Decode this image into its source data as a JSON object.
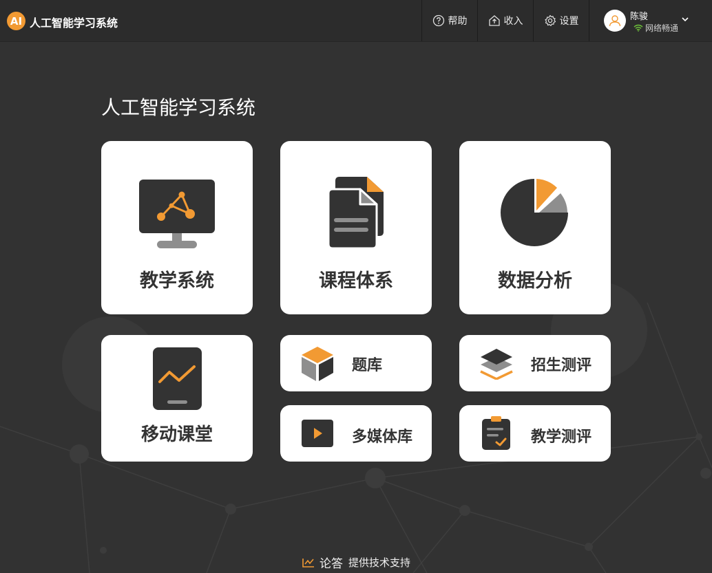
{
  "header": {
    "logo_text": "AI",
    "app_title": "人工智能学习系统",
    "nav": [
      {
        "label": "帮助",
        "icon": "help-icon"
      },
      {
        "label": "收入",
        "icon": "inbox-icon"
      },
      {
        "label": "设置",
        "icon": "gear-icon"
      }
    ],
    "user": {
      "name": "陈骏",
      "status": "网络畅通"
    }
  },
  "main": {
    "title": "人工智能学习系统",
    "cards": [
      {
        "label": "教学系统",
        "icon": "monitor-network-icon"
      },
      {
        "label": "课程体系",
        "icon": "documents-icon"
      },
      {
        "label": "数据分析",
        "icon": "pie-chart-icon"
      },
      {
        "label": "移动课堂",
        "icon": "tablet-chart-icon"
      },
      {
        "label": "题库",
        "icon": "cube-icon"
      },
      {
        "label": "招生测评",
        "icon": "layers-icon"
      },
      {
        "label": "多媒体库",
        "icon": "play-icon"
      },
      {
        "label": "教学测评",
        "icon": "clipboard-check-icon"
      }
    ]
  },
  "footer": {
    "brand": "论答",
    "text": "提供技术支持"
  },
  "colors": {
    "accent": "#f29a33",
    "background": "#323232",
    "topbar": "#2c2c2c",
    "card": "#ffffff",
    "icon_dark": "#333333",
    "icon_gray": "#8e8e8e"
  }
}
